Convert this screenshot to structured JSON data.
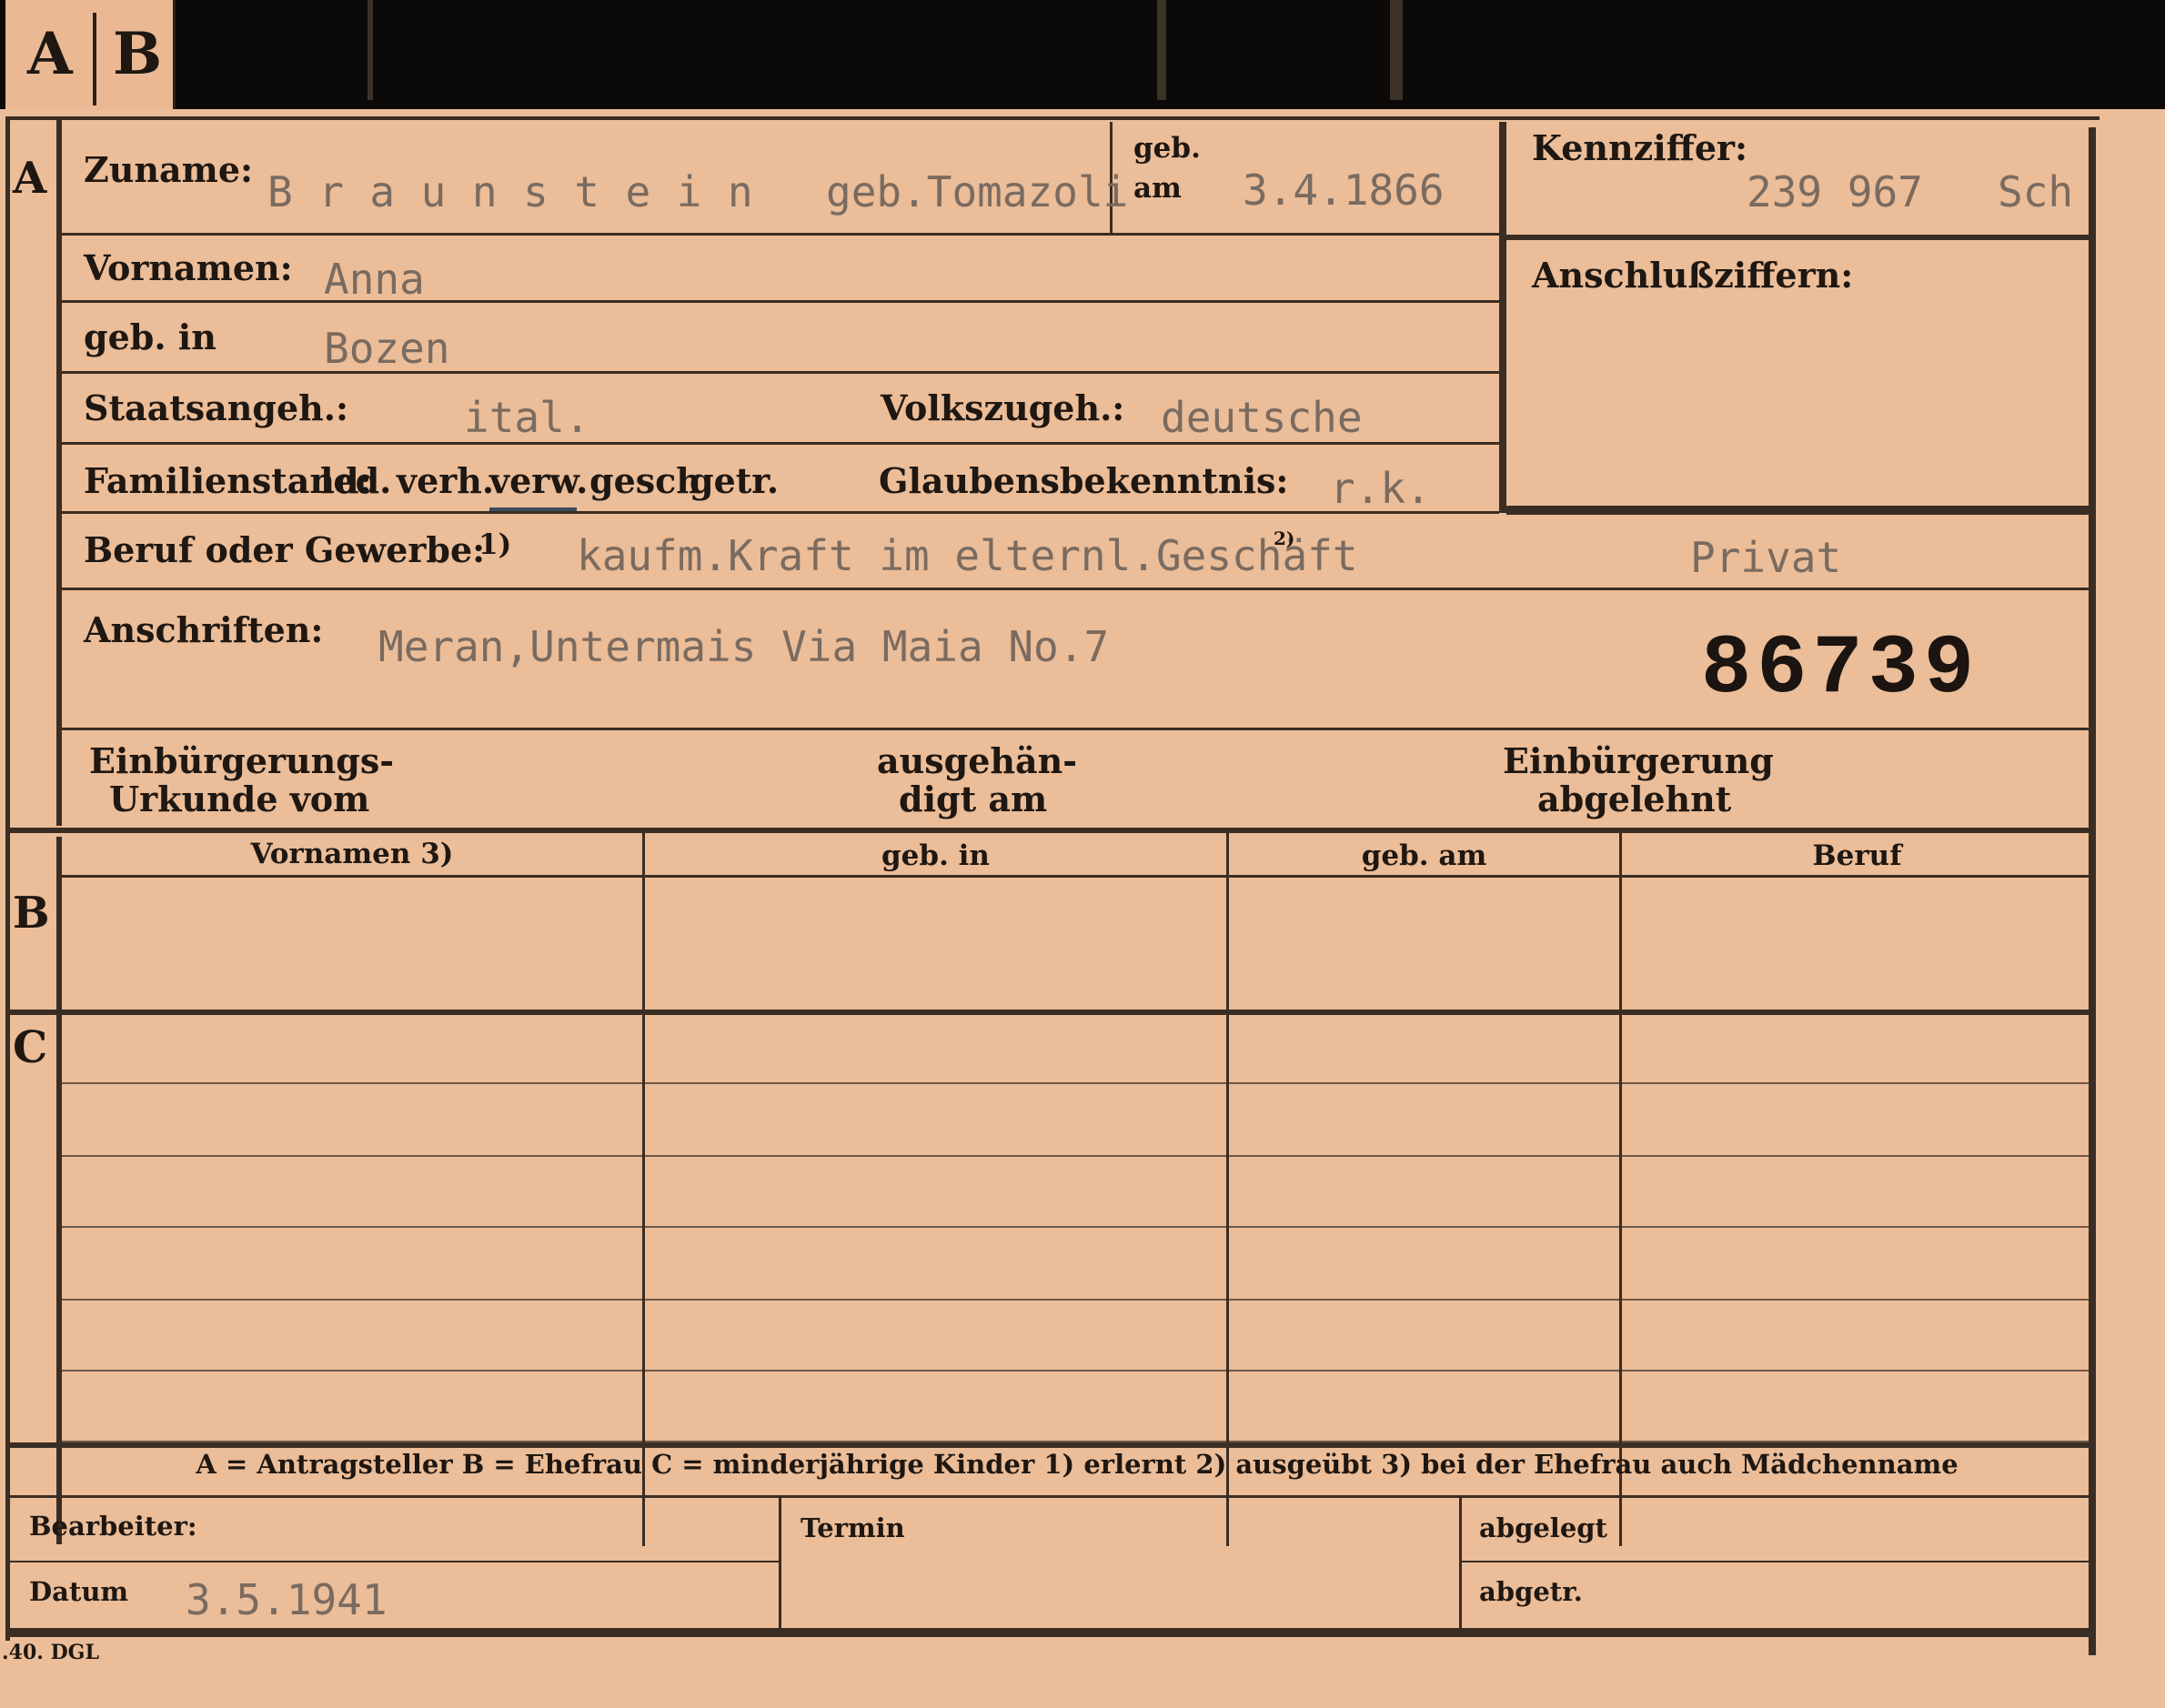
{
  "tab": {
    "letter_a": "A",
    "letter_b": "B"
  },
  "section_a": {
    "marker": "A",
    "zuname_label": "Zuname:",
    "zuname_value": "Braunstein",
    "geb_name": "geb.Tomazoli",
    "geb_am_label_top": "geb.",
    "geb_am_label_bottom": "am",
    "geb_am_value": "3.4.1866",
    "kennziffer_label": "Kennziffer:",
    "kennziffer_value": "239 967",
    "kennziffer_suffix": "Sch",
    "anschluss_label": "Anschlußziffern:",
    "vornamen_label": "Vornamen:",
    "vornamen_value": "Anna",
    "geb_in_label": "geb. in",
    "geb_in_value": "Bozen",
    "staatsangeh_label": "Staatsangeh.:",
    "staatsangeh_value": "ital.",
    "volkszugeh_label": "Volkszugeh.:",
    "volkszugeh_value": "deutsche",
    "familienstand_label": "Familienstand:",
    "familienstand_options": [
      "led.",
      "verh.",
      "verw.",
      "gesch.",
      "getr."
    ],
    "familienstand_selected": "verw.",
    "glauben_label": "Glaubensbekenntnis:",
    "glauben_value": "r.k.",
    "beruf_label": "Beruf oder Gewerbe:",
    "beruf_note_1": "1)",
    "beruf_value": "kaufm.Kraft im elternl.Geschäft",
    "beruf_note_2": "2)",
    "beruf_extra": "Privat",
    "anschriften_label": "Anschriften:",
    "anschriften_value": "Meran,Untermais Via Maia No.7",
    "stamp_number": "86739",
    "einbuerg_urkunde_1": "Einbürgerungs-",
    "einbuerg_urkunde_2": "Urkunde vom",
    "ausgehaendigt_1": "ausgehän-",
    "ausgehaendigt_2": "digt am",
    "abgelehnt_1": "Einbürgerung",
    "abgelehnt_2": "abgelehnt"
  },
  "section_b": {
    "marker": "B",
    "headers": [
      "Vornamen 3)",
      "geb. in",
      "geb. am",
      "Beruf"
    ]
  },
  "section_c": {
    "marker": "C"
  },
  "legend": {
    "text": "A = Antragsteller   B = Ehefrau   C = minderjährige Kinder   1) erlernt   2) ausgeübt   3) bei der Ehefrau auch Mädchenname"
  },
  "footer": {
    "bearbeiter_label": "Bearbeiter:",
    "datum_label": "Datum",
    "datum_value": "3.5.1941",
    "termin_label": "Termin",
    "abgelegt_label": "abgelegt",
    "abgetr_label": "abgetr.",
    "print_code": ".40. DGL"
  }
}
